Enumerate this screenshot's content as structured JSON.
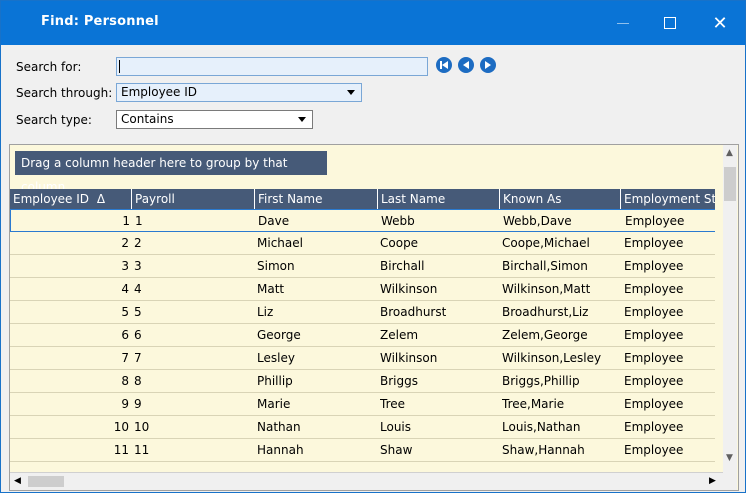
{
  "window": {
    "title": "Find: Personnel"
  },
  "titlebar": {
    "min_icon": "minimize-icon",
    "max_icon": "maximize-icon",
    "close_glyph": "✕"
  },
  "form": {
    "search_for_label": "Search for:",
    "search_for_value": "",
    "search_through_label": "Search through:",
    "search_through_value": "Employee ID",
    "search_type_label": "Search type:",
    "search_type_value": "Contains"
  },
  "nav": {
    "icons": [
      "first-record-icon",
      "previous-record-icon",
      "next-record-icon"
    ],
    "accent": "#1d6cc2"
  },
  "group_bar": {
    "text": "Drag a column header here to group by that column."
  },
  "columns": [
    "Employee ID",
    "Payroll",
    "First Name",
    "Last Name",
    "Known As",
    "Employment Statu"
  ],
  "sort_indicator": "Δ",
  "rows": [
    {
      "id": "1",
      "payroll": "1",
      "first": "Dave",
      "last": "Webb",
      "known": "Webb,Dave",
      "status": "Employee"
    },
    {
      "id": "2",
      "payroll": "2",
      "first": "Michael",
      "last": "Coope",
      "known": "Coope,Michael",
      "status": "Employee"
    },
    {
      "id": "3",
      "payroll": "3",
      "first": "Simon",
      "last": "Birchall",
      "known": "Birchall,Simon",
      "status": "Employee"
    },
    {
      "id": "4",
      "payroll": "4",
      "first": "Matt",
      "last": "Wilkinson",
      "known": "Wilkinson,Matt",
      "status": "Employee"
    },
    {
      "id": "5",
      "payroll": "5",
      "first": "Liz",
      "last": "Broadhurst",
      "known": "Broadhurst,Liz",
      "status": "Employee"
    },
    {
      "id": "6",
      "payroll": "6",
      "first": "George",
      "last": "Zelem",
      "known": "Zelem,George",
      "status": "Employee"
    },
    {
      "id": "7",
      "payroll": "7",
      "first": "Lesley",
      "last": "Wilkinson",
      "known": "Wilkinson,Lesley",
      "status": "Employee"
    },
    {
      "id": "8",
      "payroll": "8",
      "first": "Phillip",
      "last": "Briggs",
      "known": "Briggs,Phillip",
      "status": "Employee"
    },
    {
      "id": "9",
      "payroll": "9",
      "first": "Marie",
      "last": "Tree",
      "known": "Tree,Marie",
      "status": "Employee"
    },
    {
      "id": "10",
      "payroll": "10",
      "first": "Nathan",
      "last": "Louis",
      "known": "Louis,Nathan",
      "status": "Employee"
    },
    {
      "id": "11",
      "payroll": "11",
      "first": "Hannah",
      "last": "Shaw",
      "known": "Shaw,Hannah",
      "status": "Employee"
    }
  ],
  "colors": {
    "titlebar": "#0a74d6",
    "header": "#465a78",
    "grid_bg": "#fcf8dc"
  }
}
